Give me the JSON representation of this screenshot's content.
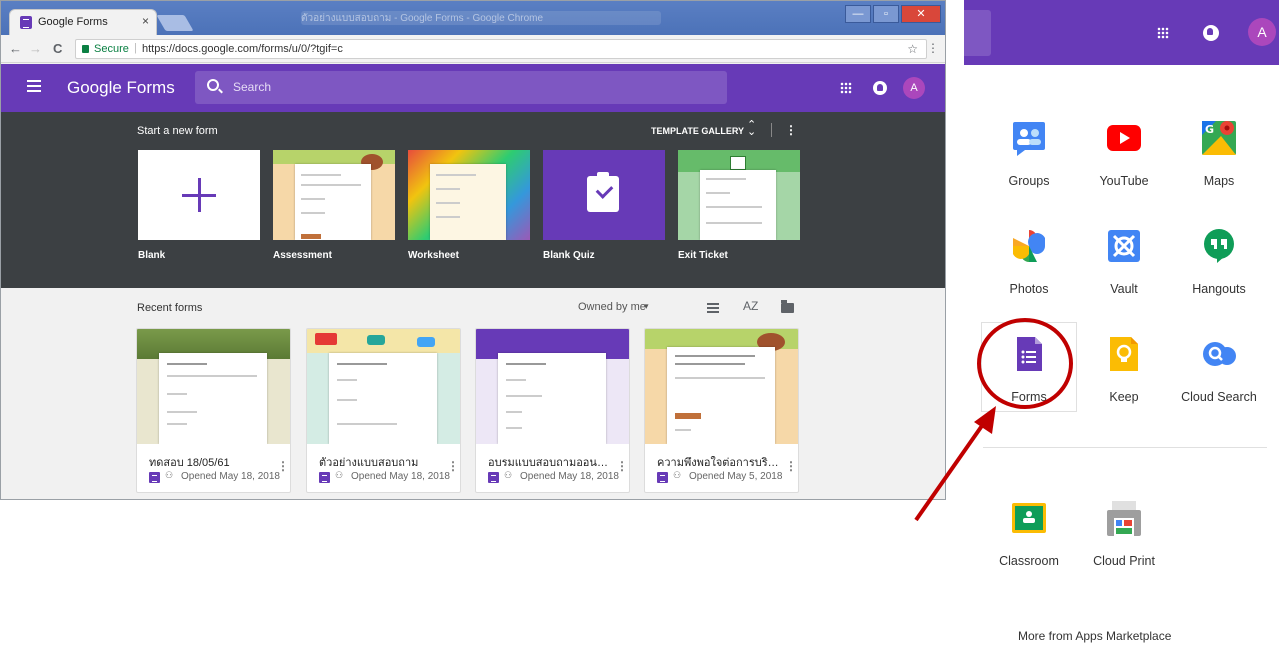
{
  "browser": {
    "tab_title": "Google Forms",
    "tab_close": "×",
    "window_title": "ตัวอย่างแบบสอบถาม - Google Forms - Google Chrome",
    "win_min": "—",
    "win_max": "▫",
    "win_close": "✕",
    "back": "←",
    "forward": "→",
    "reload": "C",
    "secure_label": "Secure",
    "url": "https://docs.google.com/forms/u/0/?tgif=c",
    "star": "☆",
    "menu": "⋮"
  },
  "header": {
    "brand": "Google Forms",
    "search_placeholder": "Search",
    "avatar": "A"
  },
  "gallery": {
    "start_label": "Start a new form",
    "template_gallery": "TEMPLATE GALLERY",
    "chevron": "⌃⌄",
    "more": "⋮",
    "templates": [
      {
        "name": "Blank"
      },
      {
        "name": "Assessment"
      },
      {
        "name": "Worksheet"
      },
      {
        "name": "Blank Quiz"
      },
      {
        "name": "Exit Ticket"
      }
    ]
  },
  "recent": {
    "label": "Recent forms",
    "owned_by": "Owned by me",
    "caret": "▾",
    "sort": "AZ",
    "forms": [
      {
        "title": "ทดสอบ 18/05/61",
        "opened": "Opened May 18, 2018"
      },
      {
        "title": "ตัวอย่างแบบสอบถาม",
        "opened": "Opened May 18, 2018"
      },
      {
        "title": "อบรมแบบสอบถามออนไลน์ ...",
        "opened": "Opened May 18, 2018"
      },
      {
        "title": "ความพึงพอใจต่อการบริการ ...",
        "opened": "Opened May 5, 2018"
      }
    ],
    "share_glyph": "⚇",
    "more_glyph": "⋮"
  },
  "apps_panel": {
    "avatar": "A",
    "apps": [
      {
        "name": "Groups"
      },
      {
        "name": "YouTube"
      },
      {
        "name": "Maps"
      },
      {
        "name": "Photos"
      },
      {
        "name": "Vault"
      },
      {
        "name": "Hangouts"
      },
      {
        "name": "Forms"
      },
      {
        "name": "Keep"
      },
      {
        "name": "Cloud Search"
      },
      {
        "name": "Classroom"
      },
      {
        "name": "Cloud Print"
      }
    ],
    "more_link": "More from Apps Marketplace"
  },
  "colors": {
    "forms_purple": "#673ab7",
    "gallery_bg": "#3c4043",
    "annotation_red": "#c00000"
  }
}
